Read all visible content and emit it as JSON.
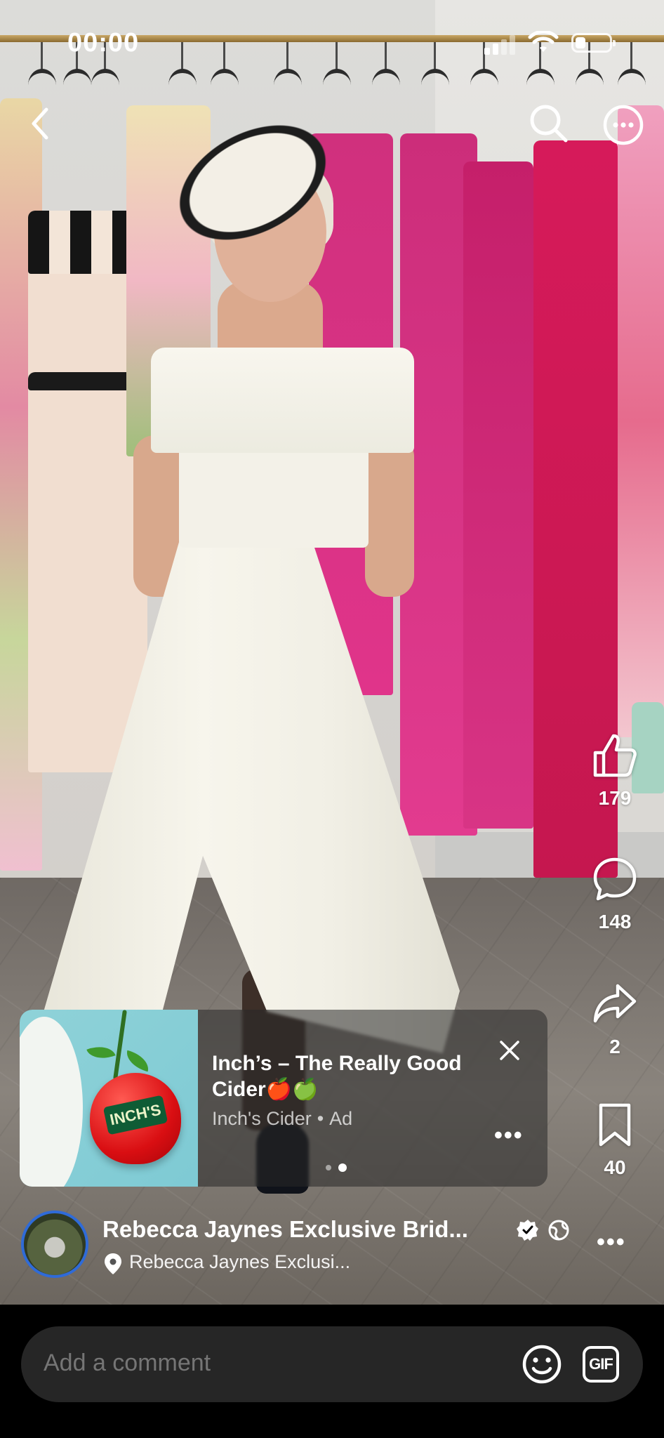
{
  "status_bar": {
    "time": "00:00"
  },
  "reactions": {
    "likes": "179",
    "comments": "148",
    "shares": "2",
    "saves": "40"
  },
  "ad": {
    "title": "Inch’s – The Really Good Cider🍎🍏",
    "advertiser": "Inch's Cider",
    "separator": "•",
    "sponsored_label": "Ad",
    "thumbnail_label": "INCH'S",
    "more_label": "•••"
  },
  "author": {
    "name": "Rebecca Jaynes Exclusive Brid...",
    "location": "Rebecca Jaynes Exclusi...",
    "more_label": "•••"
  },
  "comment_bar": {
    "placeholder": "Add a comment",
    "gif_label": "GIF"
  }
}
